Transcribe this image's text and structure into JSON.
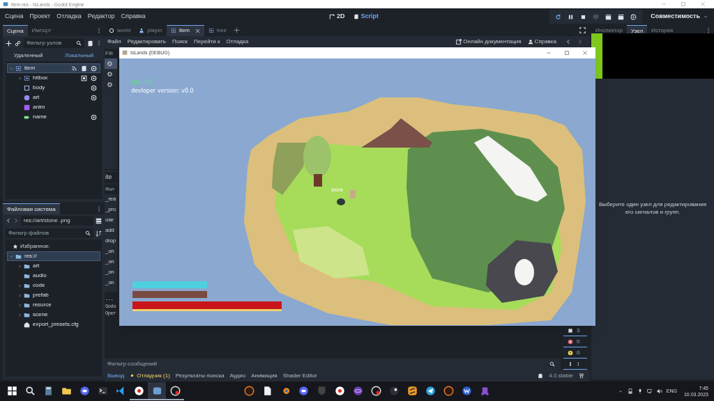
{
  "window": {
    "title": "item.res - IsLands - Godot Engine"
  },
  "menu": [
    "Сцена",
    "Проект",
    "Отладка",
    "Редактор",
    "Справка"
  ],
  "workspaces": [
    {
      "label": "2D",
      "kind": "transform",
      "selected": false
    },
    {
      "label": "Script",
      "kind": "script",
      "selected": true
    }
  ],
  "run_buttons": [
    {
      "kind": "reload",
      "disabled": false
    },
    {
      "kind": "pause",
      "disabled": false
    },
    {
      "kind": "stop",
      "disabled": false
    },
    {
      "kind": "remote",
      "disabled": true
    },
    {
      "kind": "play_scene",
      "disabled": false
    },
    {
      "kind": "play_custom",
      "disabled": false
    },
    {
      "kind": "movie",
      "disabled": false
    }
  ],
  "renderer": "Совместимость",
  "scene_dock": {
    "tabs": [
      {
        "label": "Сцена",
        "selected": true
      },
      {
        "label": "Импорт",
        "selected": false
      }
    ],
    "filter": {
      "placeholder": "Фильтр узлов"
    },
    "modes": [
      {
        "label": "Удаленный",
        "selected": false
      },
      {
        "label": "Локальный",
        "selected": true
      }
    ],
    "tree": [
      {
        "label": "item",
        "kind": "area",
        "selected": true,
        "expanded": true,
        "connected": true,
        "scripted": true,
        "visible": true,
        "children": [
          {
            "label": "hitbox",
            "kind": "area",
            "selected": false,
            "expanded": false,
            "grouped": true,
            "visible": true
          },
          {
            "label": "body",
            "kind": "body",
            "selected": false,
            "visible": true
          },
          {
            "label": "art",
            "kind": "sprite",
            "selected": false,
            "visible": true
          },
          {
            "label": "anim",
            "kind": "anim",
            "selected": false,
            "visible": false
          },
          {
            "label": "name",
            "kind": "label",
            "selected": false,
            "visible": true
          }
        ]
      }
    ]
  },
  "filesystem": {
    "tab": "Файловая система",
    "path": "res://art/stone .png",
    "filter": {
      "placeholder": "Фильтр файлов"
    },
    "favorites": "Избранное:",
    "tree": [
      {
        "label": "res://",
        "kind": "folder",
        "selected": true,
        "expanded": true,
        "children": [
          {
            "label": "art",
            "kind": "folder",
            "selected": false,
            "expanded": false
          },
          {
            "label": "audio",
            "kind": "folder",
            "selected": false
          },
          {
            "label": "code",
            "kind": "folder",
            "selected": false,
            "expanded": false
          },
          {
            "label": "prefab",
            "kind": "folder",
            "selected": false,
            "expanded": false
          },
          {
            "label": "resurce",
            "kind": "folder",
            "selected": false,
            "expanded": false
          },
          {
            "label": "scene",
            "kind": "folder",
            "selected": false,
            "expanded": false
          },
          {
            "label": "export_presets.cfg",
            "kind": "file",
            "selected": false
          }
        ]
      }
    ]
  },
  "editor_tabs": [
    {
      "label": "world",
      "kind": "world",
      "selected": false
    },
    {
      "label": "player",
      "kind": "player",
      "selected": false
    },
    {
      "label": "item",
      "kind": "area",
      "selected": true
    },
    {
      "label": "tree",
      "kind": "area",
      "selected": false
    }
  ],
  "script_menu": [
    "Файл",
    "Редактировать",
    "Поиск",
    "Перейти к",
    "Отладка"
  ],
  "help_links": [
    {
      "label": "Онлайн документация",
      "kind": "docs"
    },
    {
      "label": "Справка",
      "kind": "help"
    }
  ],
  "script_list": {
    "filter": "Filt",
    "rows": [
      {
        "selected": true
      },
      {
        "selected": false
      },
      {
        "selected": false
      }
    ],
    "header": "ite",
    "method_filter": "Фил",
    "methods": [
      "_rea",
      "_pro",
      "use",
      "add",
      "drop",
      "_on",
      "_on",
      "_on",
      "_on"
    ]
  },
  "output": {
    "lines": [
      "---",
      "Godo",
      "Oper"
    ],
    "filter": {
      "placeholder": "Фильтр сообщений"
    },
    "counters": [
      {
        "kind": "stack",
        "count": "3"
      },
      {
        "kind": "error",
        "count": "0"
      },
      {
        "kind": "warning",
        "count": "0"
      },
      {
        "kind": "info",
        "count": "1"
      }
    ]
  },
  "bottom_tabs": [
    {
      "label": "Вывод",
      "selected": true
    },
    {
      "label": "Отладчик (1)",
      "selected": false,
      "alert": true
    },
    {
      "label": "Результаты поиска",
      "selected": false
    },
    {
      "label": "Аудио",
      "selected": false
    },
    {
      "label": "Анимация",
      "selected": false
    },
    {
      "label": "Shader Editor",
      "selected": false
    }
  ],
  "version": "4.0.stable",
  "right_dock": {
    "tabs": [
      {
        "label": "Инспектор",
        "selected": false
      },
      {
        "label": "Узел",
        "selected": true
      },
      {
        "label": "История",
        "selected": false
      }
    ],
    "message": "Выберите один узел для редактирования его сигналов и групп."
  },
  "game_window": {
    "title": "IsLands (DEBUG)",
    "fps": "fps: 90",
    "version": "devloper version: v0.0",
    "item_label": "stone"
  },
  "taskbar": {
    "apps": [
      {
        "kind": "start",
        "running": false
      },
      {
        "kind": "search",
        "running": false
      },
      {
        "kind": "calculator",
        "running": false
      },
      {
        "kind": "folder",
        "running": false
      },
      {
        "kind": "chat",
        "running": false
      },
      {
        "kind": "terminal",
        "running": false
      },
      {
        "kind": "code",
        "running": false
      },
      {
        "kind": "browser",
        "running": true
      },
      {
        "kind": "robot",
        "running": true,
        "selected": true
      },
      {
        "kind": "record",
        "running": true
      },
      {
        "kind": "ring",
        "running": false
      },
      {
        "kind": "document",
        "running": false
      },
      {
        "kind": "orbit",
        "running": false
      },
      {
        "kind": "chat",
        "running": false
      },
      {
        "kind": "shield",
        "running": false
      },
      {
        "kind": "browser",
        "running": false
      },
      {
        "kind": "atom",
        "running": false
      },
      {
        "kind": "record",
        "running": false
      },
      {
        "kind": "piston",
        "running": false
      },
      {
        "kind": "stripes",
        "running": false
      },
      {
        "kind": "plane",
        "running": false
      },
      {
        "kind": "ring",
        "running": false
      },
      {
        "kind": "badge",
        "running": false
      },
      {
        "kind": "creature",
        "running": false
      }
    ],
    "language": "ENG",
    "time": "7:45",
    "date": "10.03.2023"
  }
}
